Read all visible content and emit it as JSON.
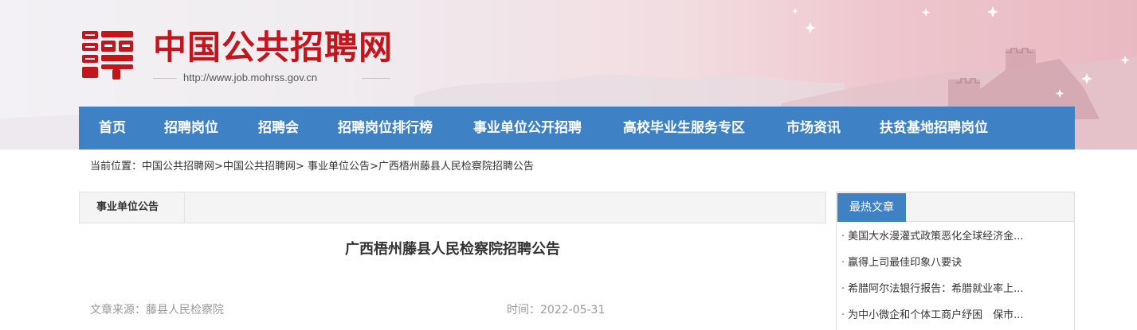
{
  "header": {
    "site_name": "中国公共招聘网",
    "site_url": "http://www.job.mohrss.gov.cn",
    "logo_glyph": "聘",
    "brand_color": "#c3161c"
  },
  "nav": {
    "items": [
      {
        "label": "首页"
      },
      {
        "label": "招聘岗位"
      },
      {
        "label": "招聘会"
      },
      {
        "label": "招聘岗位排行榜"
      },
      {
        "label": "事业单位公开招聘"
      },
      {
        "label": "高校毕业生服务专区"
      },
      {
        "label": "市场资讯"
      },
      {
        "label": "扶贫基地招聘岗位"
      }
    ],
    "background": "#3e82c5"
  },
  "breadcrumb": {
    "prefix": "当前位置：",
    "links": [
      "中国公共招聘网",
      "中国公共招聘网",
      "事业单位公告",
      "广西梧州藤县人民检察院招聘公告"
    ],
    "separators": [
      ">",
      "> ",
      ">"
    ]
  },
  "category": {
    "tab_label": "事业单位公告"
  },
  "article": {
    "title": "广西梧州藤县人民检察院招聘公告",
    "source_label": "文章来源：",
    "source": "藤县人民检察院",
    "time_label": "时间：",
    "time": "2022-05-31"
  },
  "sidebar": {
    "tab_label": "最热文章",
    "items": [
      {
        "text": "美国大水漫灌式政策恶化全球经济金..."
      },
      {
        "text": "赢得上司最佳印象八要诀"
      },
      {
        "text": "希腊阿尔法银行报告：希腊就业率上..."
      },
      {
        "text": "为中小微企和个体工商户纾困　保市..."
      }
    ],
    "bullet": "·"
  }
}
